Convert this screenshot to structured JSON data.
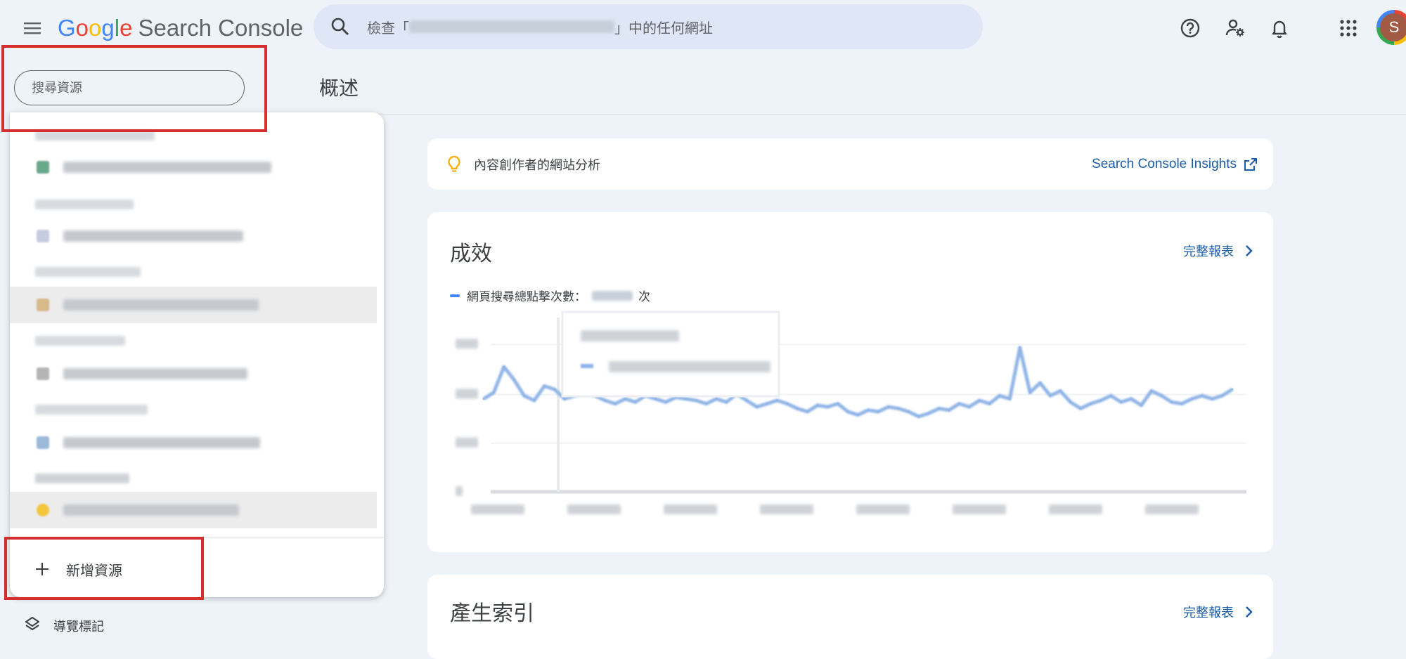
{
  "app": {
    "name_letters": [
      "G",
      "o",
      "o",
      "g",
      "l",
      "e"
    ],
    "product": "Search Console"
  },
  "search": {
    "prefix": "檢查「",
    "suffix": "」中的任何網址"
  },
  "property_search": {
    "placeholder": "搜尋資源"
  },
  "property_dropdown": {
    "add_property_label": "新增資源",
    "items": [
      {
        "favicon_color": "#6aa88c",
        "selected": false
      },
      {
        "favicon_color": "#c6cbe0",
        "selected": false
      },
      {
        "favicon_color": "#d7b98a",
        "selected": true
      },
      {
        "favicon_color": "#b5b5b5",
        "selected": false
      },
      {
        "favicon_color": "#9bbad8",
        "selected": false
      },
      {
        "favicon_color": "#f2c53b",
        "selected": true
      }
    ],
    "group_label_visible": "UR..XX.COM.TW"
  },
  "page": {
    "title": "概述"
  },
  "nav_bottom": {
    "label": "導覽標記"
  },
  "insights_card": {
    "label": "內容創作者的網站分析",
    "link_label": "Search Console Insights"
  },
  "performance_card": {
    "title": "成效",
    "full_report": "完整報表",
    "legend_label": "網頁搜尋總點擊次數：",
    "legend_unit": "次"
  },
  "index_card": {
    "title": "產生索引",
    "full_report": "完整報表"
  },
  "colors": {
    "accent": "#1a5ca8",
    "highlight_box": "#d32f2f",
    "series": "#8fb4e6"
  },
  "chart_data": {
    "type": "line",
    "series": [
      {
        "values": [
          58,
          62,
          78,
          70,
          60,
          57,
          66,
          64,
          58,
          60,
          61,
          60,
          57,
          55,
          58,
          56,
          60,
          58,
          56,
          59,
          58,
          57,
          55,
          58,
          56,
          61,
          57,
          53,
          55,
          57,
          55,
          52,
          50,
          54,
          53,
          55,
          50,
          48,
          51,
          50,
          53,
          52,
          50,
          47,
          49,
          52,
          51,
          55,
          53,
          57,
          55,
          60,
          58,
          90,
          62,
          68,
          60,
          63,
          56,
          52,
          55,
          57,
          60,
          56,
          58,
          54,
          63,
          60,
          56,
          55,
          58,
          60,
          58,
          60,
          64
        ]
      }
    ],
    "grid": true,
    "legend": "top-left"
  }
}
